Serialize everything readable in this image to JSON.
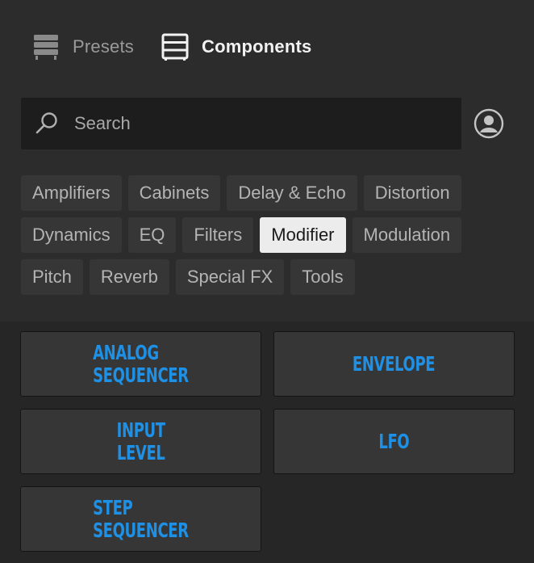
{
  "tabs": {
    "presets_label": "Presets",
    "components_label": "Components"
  },
  "search": {
    "placeholder": "Search",
    "value": ""
  },
  "categories": {
    "row1": [
      "Amplifiers",
      "Cabinets",
      "Delay & Echo",
      "Distortion"
    ],
    "row2": [
      "Dynamics",
      "EQ",
      "Filters",
      "Modifier",
      "Modulation"
    ],
    "row3": [
      "Pitch",
      "Reverb",
      "Special FX",
      "Tools"
    ],
    "selected": "Modifier"
  },
  "components": [
    {
      "title": "ANALOG\nSEQUENCER"
    },
    {
      "title": "ENVELOPE"
    },
    {
      "title": "INPUT\nLEVEL"
    },
    {
      "title": "LFO"
    },
    {
      "title": "STEP\nSEQUENCER"
    }
  ],
  "colors": {
    "accent": "#1e90e6",
    "selected_chip_bg": "#ececec",
    "panel_bg": "#2c2c2c"
  }
}
